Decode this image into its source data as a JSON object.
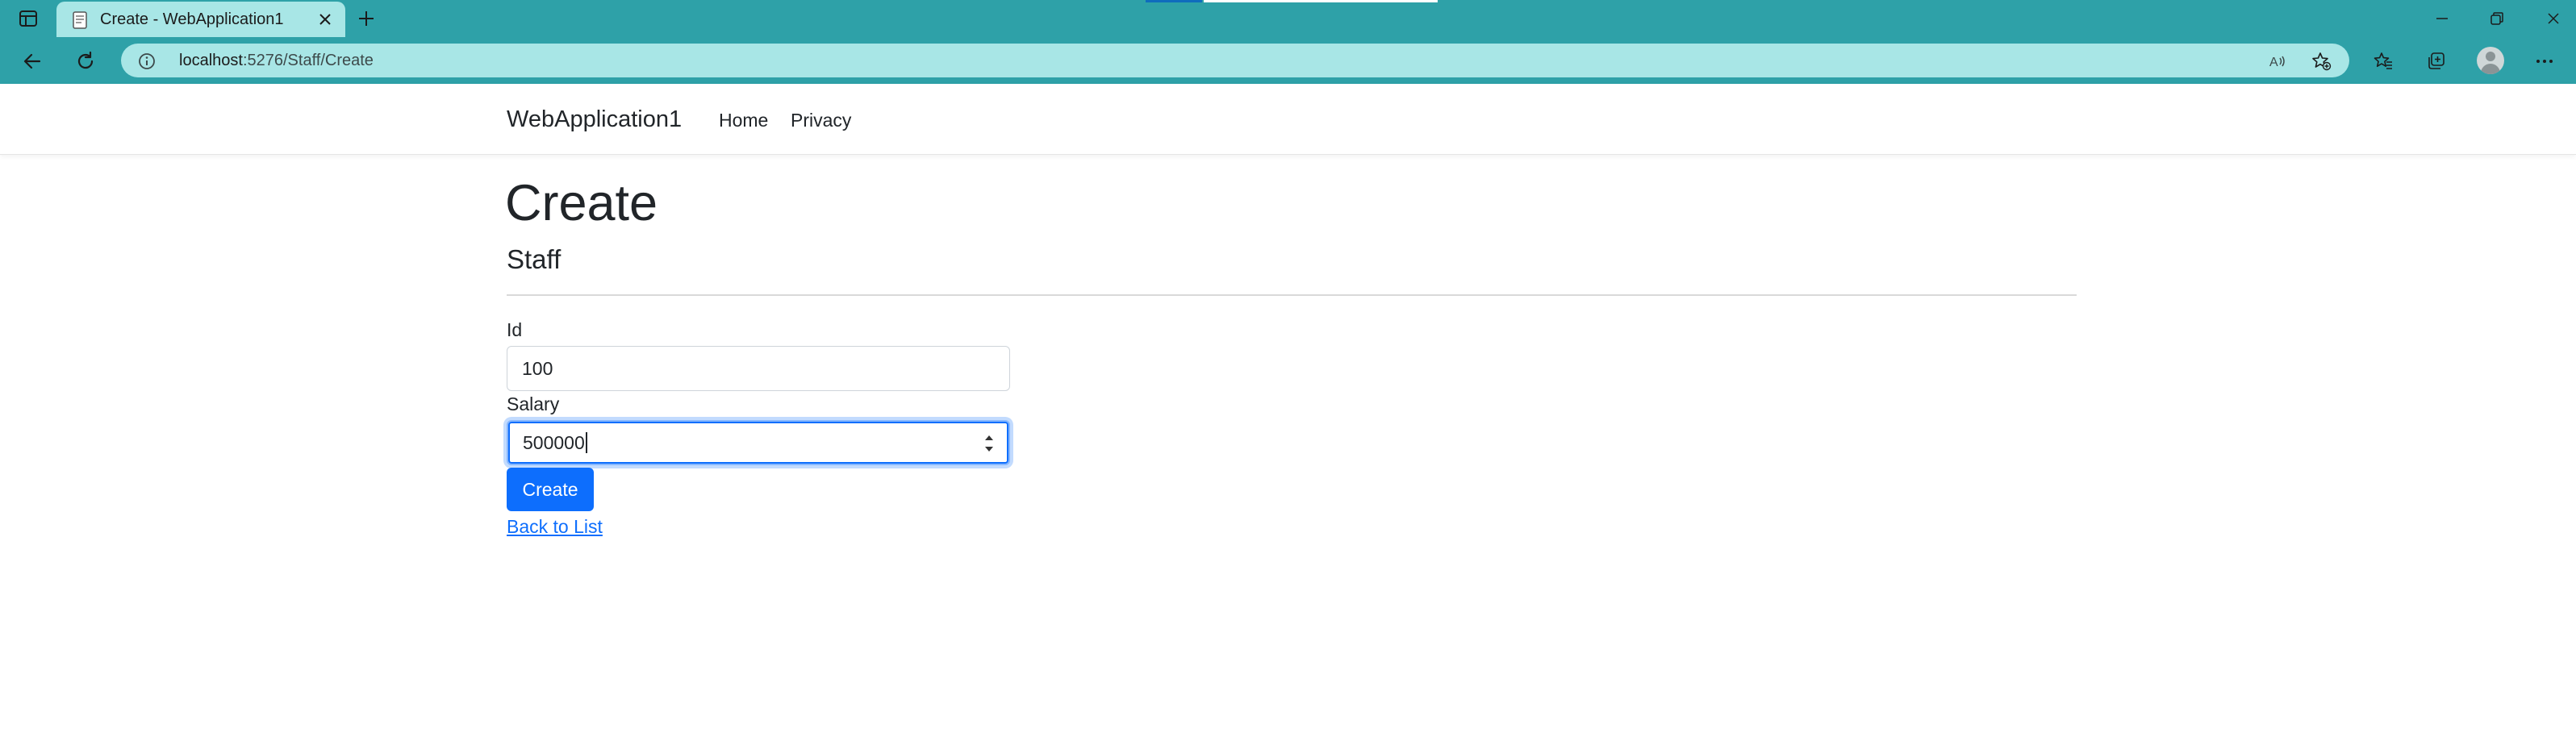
{
  "browser": {
    "tab_title": "Create - WebApplication1",
    "url_host": "localhost",
    "url_rest": ":5276/Staff/Create"
  },
  "navbar": {
    "brand": "WebApplication1",
    "links": [
      {
        "label": "Home"
      },
      {
        "label": "Privacy"
      }
    ]
  },
  "page": {
    "heading": "Create",
    "subheading": "Staff"
  },
  "form": {
    "id_label": "Id",
    "id_value": "100",
    "salary_label": "Salary",
    "salary_value": "500000",
    "submit_label": "Create",
    "back_link": "Back to List"
  },
  "colors": {
    "browser_chrome": "#2ea1a8",
    "active_tab": "#a8e6e6",
    "primary": "#0d6efd",
    "text": "#212529"
  }
}
